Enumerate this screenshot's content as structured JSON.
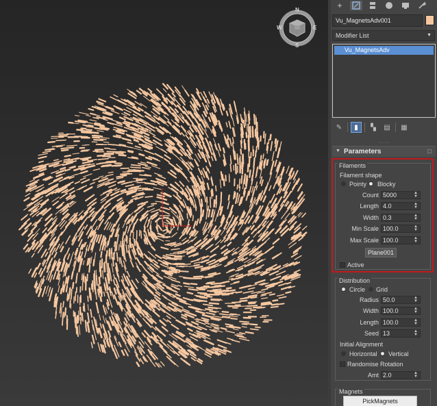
{
  "viewport": {
    "viewcube": {
      "north": "N",
      "south": "S",
      "west": "W",
      "east": "E"
    },
    "object_color": "#f5c7a0",
    "background_top": "#252525"
  },
  "panel": {
    "toolbar_icons": [
      "create-icon",
      "modify-icon",
      "hierarchy-icon",
      "motion-icon",
      "display-icon",
      "utilities-icon"
    ],
    "object_name": "Vu_MagnetsAdv001",
    "object_color": "#f5c7a0",
    "modifier_list_label": "Modifier List",
    "stack_items": [
      "Vu_MagnetsAdv"
    ],
    "stack_tools": [
      "pin-stack-icon",
      "show-end-result-icon",
      "make-unique-icon",
      "remove-modifier-icon",
      "configure-modifier-sets-icon"
    ],
    "rollout_title": "Parameters",
    "highlight_color": "#c3191d",
    "filaments": {
      "group_title": "Filaments",
      "shape_label": "Filament shape",
      "shape_options": [
        "Pointy",
        "Blocky"
      ],
      "shape_selected": "Blocky",
      "fields": [
        {
          "label": "Count",
          "value": "5000"
        },
        {
          "label": "Length",
          "value": "4.0"
        },
        {
          "label": "Width",
          "value": "0.3"
        },
        {
          "label": "Min Scale",
          "value": "100.0"
        },
        {
          "label": "Max Scale",
          "value": "100.0"
        }
      ],
      "plane_button": "Plane001",
      "active_label": "Active",
      "active_checked": false
    },
    "distribution": {
      "group_title": "Distribution",
      "options": [
        "Circle",
        "Grid"
      ],
      "selected": "Circle",
      "fields": [
        {
          "label": "Radius",
          "value": "50.0"
        },
        {
          "label": "Width",
          "value": "100.0"
        },
        {
          "label": "Length",
          "value": "100.0"
        },
        {
          "label": "Seed",
          "value": "13"
        }
      ],
      "alignment_label": "Initial Alignment",
      "alignment_options": [
        "Horizontal",
        "Vertical"
      ],
      "alignment_selected": "Vertical",
      "randomise_label": "Randomise Rotation",
      "randomise_checked": false,
      "amt_label": "Amt",
      "amt_value": "2.0"
    },
    "magnets": {
      "group_title": "Magnets",
      "pick_button": "PickMagnets"
    }
  }
}
